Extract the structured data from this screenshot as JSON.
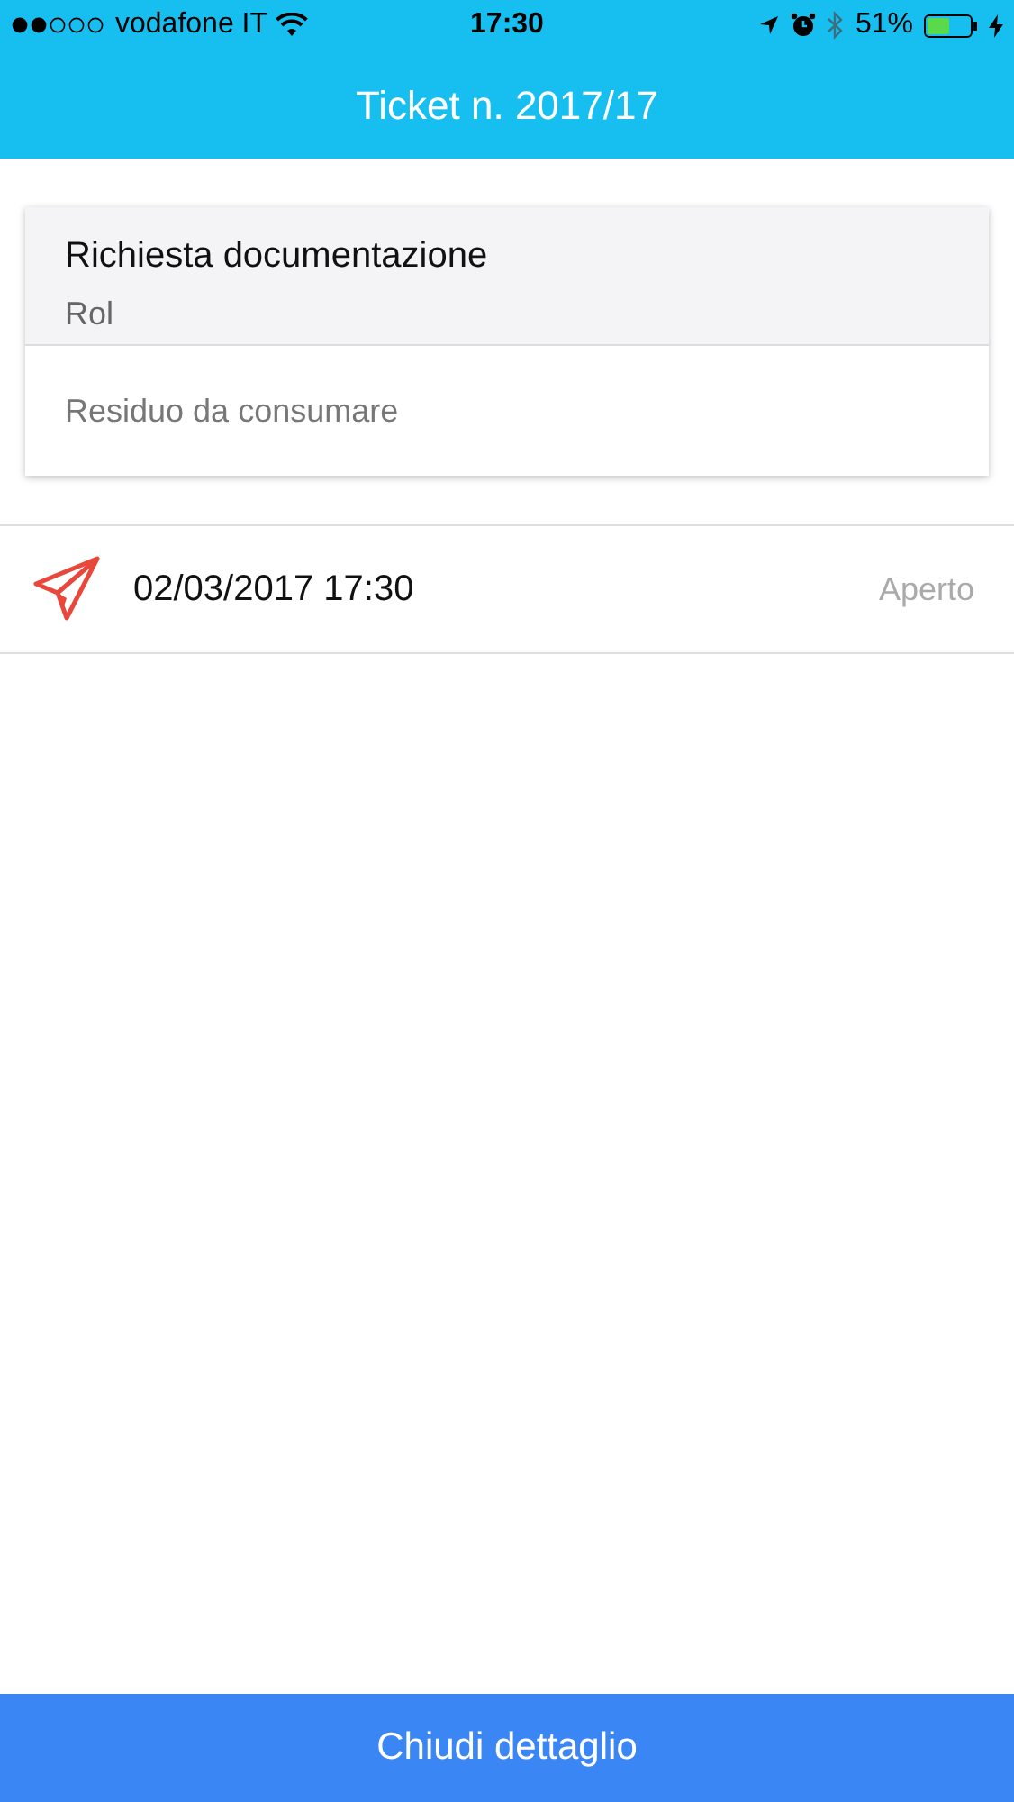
{
  "status_bar": {
    "carrier": "vodafone IT",
    "time": "17:30",
    "battery": "51%"
  },
  "nav_bar": {
    "title": "Ticket n. 2017/17"
  },
  "card": {
    "title": "Richiesta documentazione",
    "subtitle": "Rol",
    "note": "Residuo da consumare"
  },
  "events": [
    {
      "datetime": "02/03/2017 17:30",
      "status": "Aperto"
    }
  ],
  "footer_button": {
    "label": "Chiudi dettaglio"
  }
}
